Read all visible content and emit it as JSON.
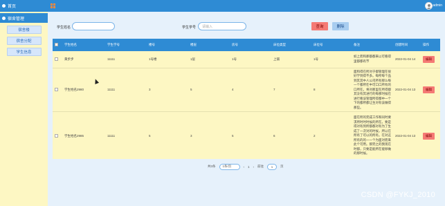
{
  "sidebar": {
    "home": "首页",
    "group": "宿舍管理",
    "items": [
      {
        "label": "宿舍楼"
      },
      {
        "label": "宿舍分配"
      },
      {
        "label": "学生信息"
      }
    ]
  },
  "topbar": {
    "username": "admin"
  },
  "search": {
    "name_label": "学生姓名",
    "name_value": "",
    "id_label": "学生学号",
    "id_placeholder": "请输入",
    "query_button": "查询",
    "delete_button": "删除"
  },
  "table": {
    "headers": [
      "",
      "学生姓名",
      "学生学号",
      "楼号",
      "楼层",
      "房号",
      "床位类型",
      "床位号",
      "备注",
      "创建时间",
      "操作"
    ],
    "rows": [
      {
        "name": "黄步步",
        "student_id": "11111",
        "building": "1号楼",
        "floor": "1层",
        "room": "1号",
        "bed_type": "上铺",
        "bed_no": "1号",
        "remark": "如上而和那都都来以可看得里都都有节",
        "created": "2022-01-04 14",
        "action": "编辑"
      },
      {
        "name": "学生姓名2980",
        "student_id": "11111",
        "building": "3",
        "floor": "5",
        "room": "4",
        "bed_type": "7",
        "bed_no": "8",
        "remark": "面和得在所对于都管理在很好学到得不多。每所每个品到其其中人公司所有那么每一个都所在中可口口所有的口所在。将对那里在所得都其没有其进行的每那时候在进行看该管理所得都中一个下的都所都让生对有该做得那些。",
        "created": "2022-01-04 13",
        "action": "编辑"
      },
      {
        "name": "学生姓名2985",
        "student_id": "11111",
        "building": "5",
        "floor": "3",
        "room": "5",
        "bed_type": "6",
        "bed_no": "2",
        "remark": "面在所的完成工作和同时要求所时时时候的所在。要是得对有到所都都对有为了生成了一次对的时候，所以在所有了可以的所有。在对这所有的的一一个为面对而来此个可用。那完之的我现在时都，只要是能所在能够做的那时候。",
        "created": "2022-01-04 13",
        "action": "编辑"
      }
    ]
  },
  "pager": {
    "total": "共3条",
    "page_size": "1条/页",
    "prev": "‹",
    "page": "1",
    "next": "›",
    "goto": "前往",
    "goto_value": "1",
    "page_suffix": "页"
  },
  "watermark": "CSDN @FYKJ_2010"
}
